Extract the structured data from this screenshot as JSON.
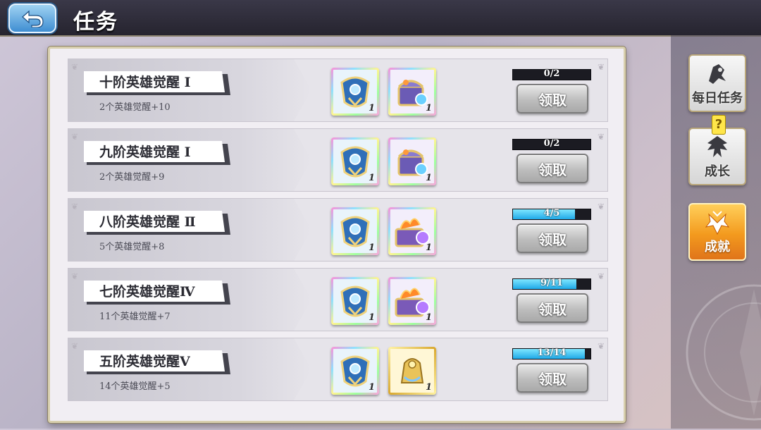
{
  "header": {
    "title": "任务",
    "back_icon": "back-arrow-icon"
  },
  "tabs": [
    {
      "label": "每日任务",
      "icon": "daily-quest-icon",
      "active": false
    },
    {
      "label": "成长",
      "icon": "growth-icon",
      "active": false,
      "badge": "?"
    },
    {
      "label": "成就",
      "icon": "achievement-icon",
      "active": true
    }
  ],
  "quests": [
    {
      "title": "十阶英雄觉醒 Ⅰ",
      "desc": "2个英雄觉醒+10",
      "progress_text": "0/2",
      "progress": 0.0,
      "claim_label": "领取",
      "rewards": [
        {
          "icon": "crest-shield-icon",
          "count": "1"
        },
        {
          "icon": "treasure-chest-icon",
          "count": "1"
        }
      ]
    },
    {
      "title": "九阶英雄觉醒 Ⅰ",
      "desc": "2个英雄觉醒+9",
      "progress_text": "0/2",
      "progress": 0.0,
      "claim_label": "领取",
      "rewards": [
        {
          "icon": "crest-shield-icon",
          "count": "1"
        },
        {
          "icon": "treasure-chest-icon",
          "count": "1"
        }
      ]
    },
    {
      "title": "八阶英雄觉醒 Ⅱ",
      "desc": "5个英雄觉醒+8",
      "progress_text": "4/5",
      "progress": 0.8,
      "claim_label": "领取",
      "rewards": [
        {
          "icon": "crest-shield-icon",
          "count": "1"
        },
        {
          "icon": "potion-chest-icon",
          "count": "1"
        }
      ]
    },
    {
      "title": "七阶英雄觉醒Ⅳ",
      "desc": "11个英雄觉醒+7",
      "progress_text": "9/11",
      "progress": 0.818,
      "claim_label": "领取",
      "rewards": [
        {
          "icon": "crest-shield-icon",
          "count": "1"
        },
        {
          "icon": "potion-chest-icon",
          "count": "1"
        }
      ]
    },
    {
      "title": "五阶英雄觉醒Ⅴ",
      "desc": "14个英雄觉醒+5",
      "progress_text": "13/14",
      "progress": 0.929,
      "claim_label": "领取",
      "rewards": [
        {
          "icon": "crest-shield-icon",
          "count": "1",
          "frame": "rainbow"
        },
        {
          "icon": "gold-relic-icon",
          "count": "1",
          "frame": "gold"
        }
      ]
    }
  ],
  "colors": {
    "progress_fill": "#1fa9e8",
    "active_tab": "#f39a1e",
    "topbar": "#26242f"
  }
}
